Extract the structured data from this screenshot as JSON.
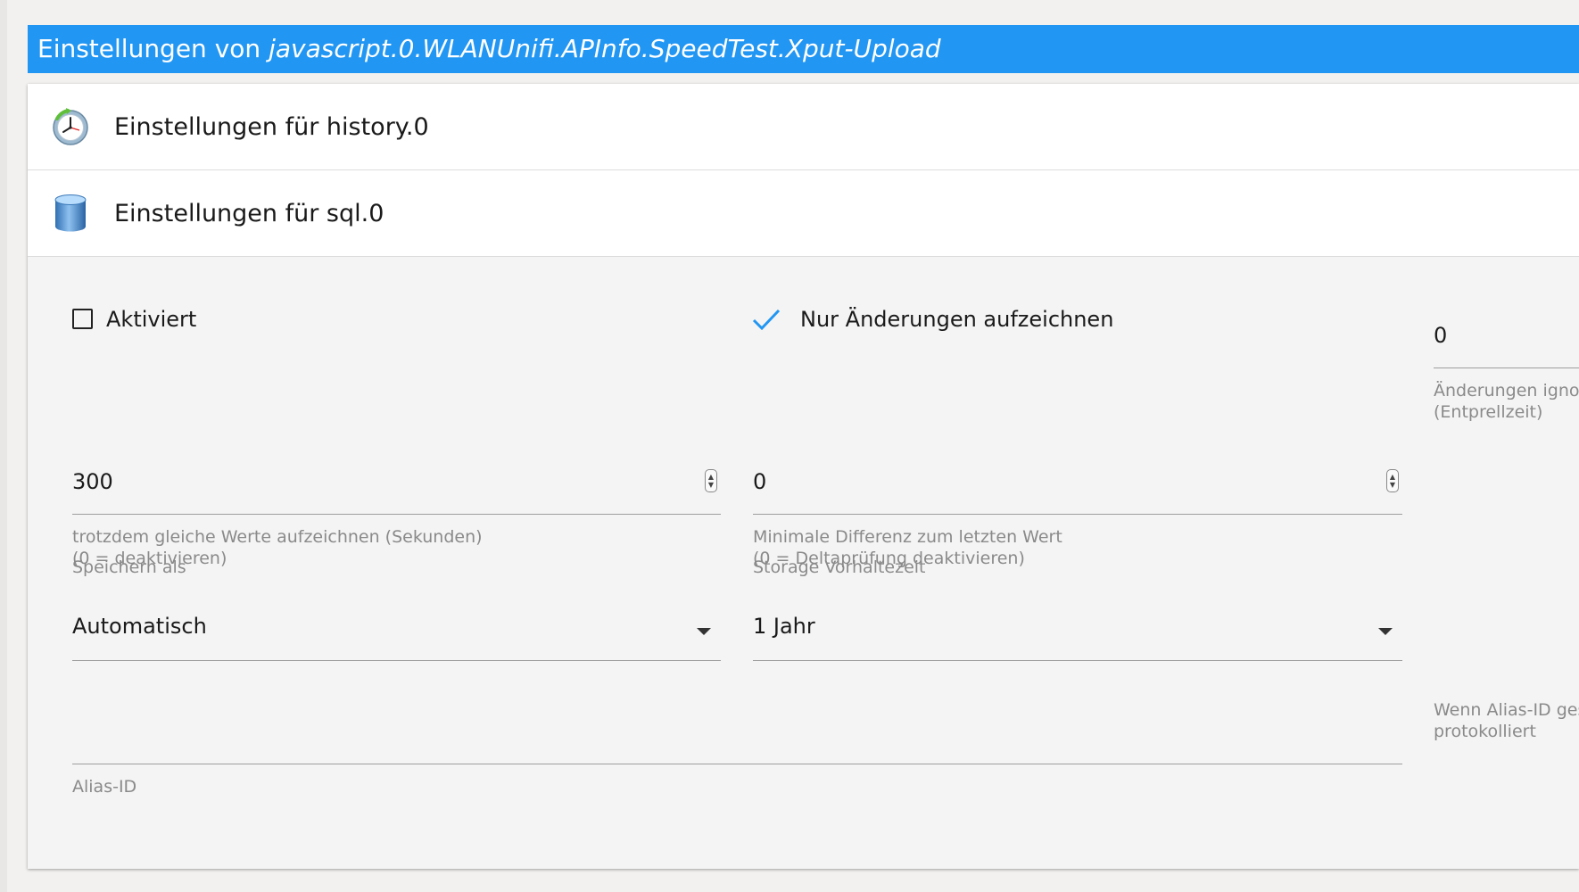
{
  "header": {
    "prefix": "Einstellungen von",
    "object_id": "javascript.0.WLANUnifi.APInfo.SpeedTest.Xput-Upload"
  },
  "sections": {
    "history": {
      "title": "Einstellungen für history.0",
      "icon": "clock-icon"
    },
    "sql": {
      "title": "Einstellungen für sql.0",
      "icon": "database-icon"
    }
  },
  "form": {
    "enabled": {
      "label": "Aktiviert",
      "checked": false
    },
    "changes_only": {
      "label": "Nur Änderungen aufzeichnen",
      "checked": true
    },
    "debounce": {
      "value": "0",
      "help_line1": "Änderungen ignori",
      "help_line2": "(Entprellzeit)"
    },
    "same_values": {
      "value": "300",
      "help_line1": "trotzdem gleiche Werte aufzeichnen (Sekunden)",
      "help_line2": "(0 = deaktivieren)"
    },
    "min_diff": {
      "value": "0",
      "help_line1": "Minimale Differenz zum letzten Wert",
      "help_line2": "(0 = Deltaprüfung deaktivieren)"
    },
    "store_as": {
      "label": "Speichern als",
      "value": "Automatisch"
    },
    "retention": {
      "label": "Storage Vorhaltezeit",
      "value": "1 Jahr"
    },
    "alias": {
      "label": "Alias-ID",
      "value": "",
      "help_line1": "Wenn Alias-ID ges",
      "help_line2": "protokolliert"
    }
  },
  "colors": {
    "accent": "#2196f3",
    "checkmark": "#2196f3",
    "panel_bg": "#f4f4f4",
    "page_bg": "#f3f1ef"
  }
}
